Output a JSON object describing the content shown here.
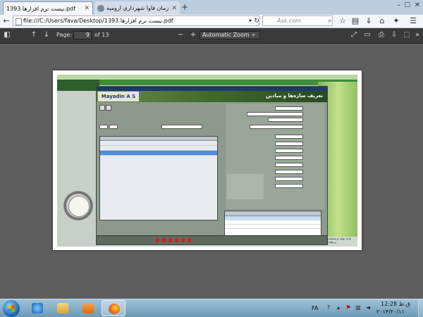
{
  "browser": {
    "tabs": [
      {
        "label": "نیست نرم افزارها 1393.pdf",
        "active": true
      },
      {
        "label": "سازمان فاوا شهرداری ارومیه ...",
        "active": false
      }
    ],
    "new_tab": "+",
    "url": "file:///C:/Users/fava/Desktop/1393 نیست نرم افزارها.pdf",
    "search_placeholder": "Ask.com"
  },
  "pdf_toolbar": {
    "page_label": "Page:",
    "page_value": "9",
    "page_total": "of 13",
    "zoom_out": "−",
    "zoom_in": "+",
    "zoom_value": "Automatic Zoom ÷"
  },
  "document": {
    "app_title": "Mayadin A S",
    "app_heading": "تعریف سازه‌ها و میادین",
    "footer_text": "واحد تولید و پشتیبانی نرم‌افزار"
  },
  "taskbar": {
    "language": "FA",
    "time": "12:28 ق.ظ",
    "date": "۲۰۱۴/۲۰/۱۱"
  }
}
